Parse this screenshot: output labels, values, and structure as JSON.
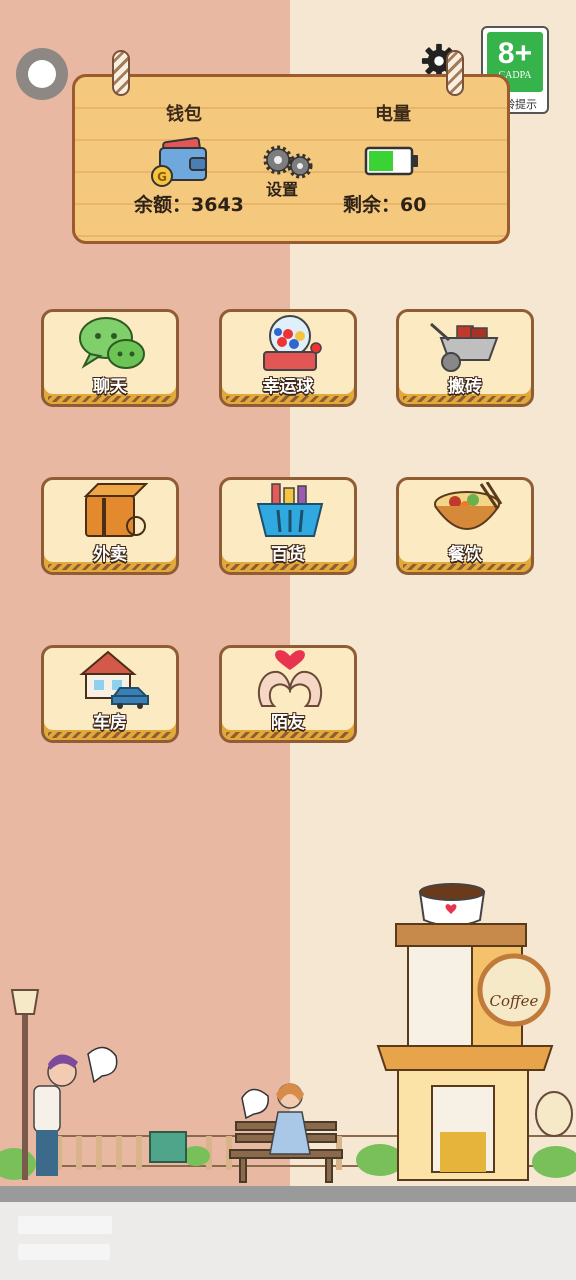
{
  "header": {
    "wallet_title": "钱包",
    "power_title": "电量",
    "settings_label": "设置",
    "balance_label": "余额：",
    "balance_value": "3643",
    "remain_label": "剩余：",
    "remain_value": "60",
    "battery_level": 0.6
  },
  "age_rating": {
    "rating": "8+",
    "org": "CADPA",
    "tip": "适龄提示"
  },
  "apps": [
    {
      "label": "聊天",
      "icon": "chat-icon"
    },
    {
      "label": "幸运球",
      "icon": "lucky-ball-icon"
    },
    {
      "label": "搬砖",
      "icon": "wheelbarrow-icon"
    },
    {
      "label": "外卖",
      "icon": "delivery-box-icon"
    },
    {
      "label": "百货",
      "icon": "shopping-basket-icon"
    },
    {
      "label": "餐饮",
      "icon": "food-bowl-icon"
    },
    {
      "label": "车房",
      "icon": "house-car-icon"
    },
    {
      "label": "陌友",
      "icon": "heart-hands-icon"
    }
  ],
  "scene": {
    "coffee_sign": "Coffee"
  },
  "colors": {
    "left_bg": "#e8b8a3",
    "right_bg": "#f5e7d2",
    "board": "#f4c97e",
    "tile": "#fbeac2",
    "tile_border": "#8f5c34",
    "battery": "#39d334"
  }
}
